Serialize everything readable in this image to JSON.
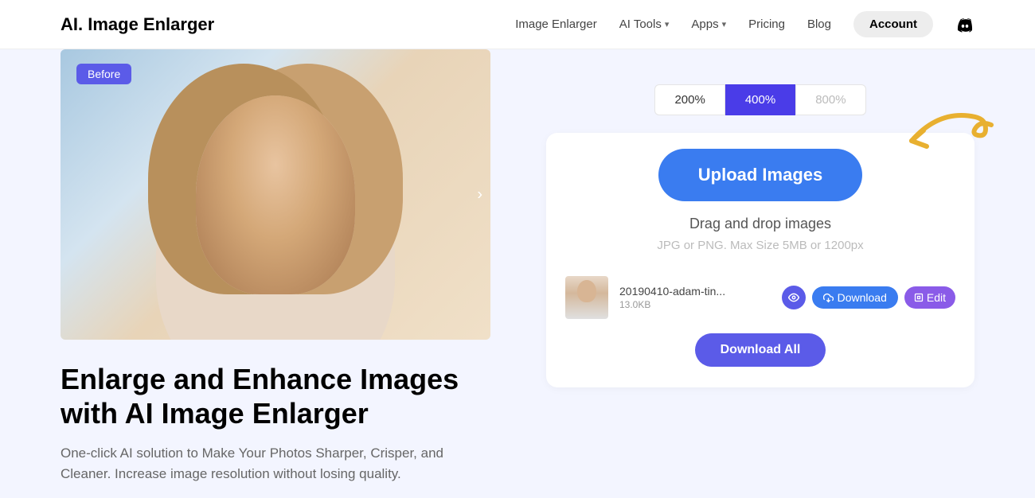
{
  "header": {
    "logo": "AI. Image Enlarger",
    "nav": {
      "image_enlarger": "Image Enlarger",
      "ai_tools": "AI Tools",
      "apps": "Apps",
      "pricing": "Pricing",
      "blog": "Blog",
      "account": "Account"
    }
  },
  "hero": {
    "badge": "Before",
    "headline": "Enlarge and Enhance Images with AI Image Enlarger",
    "subhead": "One-click AI solution to Make Your Photos Sharper, Crisper, and Cleaner. Increase image resolution without losing quality."
  },
  "zoom": {
    "opt1": "200%",
    "opt2": "400%",
    "opt3": "800%"
  },
  "upload": {
    "button": "Upload Images",
    "drag": "Drag and drop images",
    "hint": "JPG or PNG. Max Size 5MB or 1200px"
  },
  "file": {
    "name": "20190410-adam-tin...",
    "size": "13.0KB",
    "download": "Download",
    "edit": "Edit"
  },
  "download_all": "Download All"
}
